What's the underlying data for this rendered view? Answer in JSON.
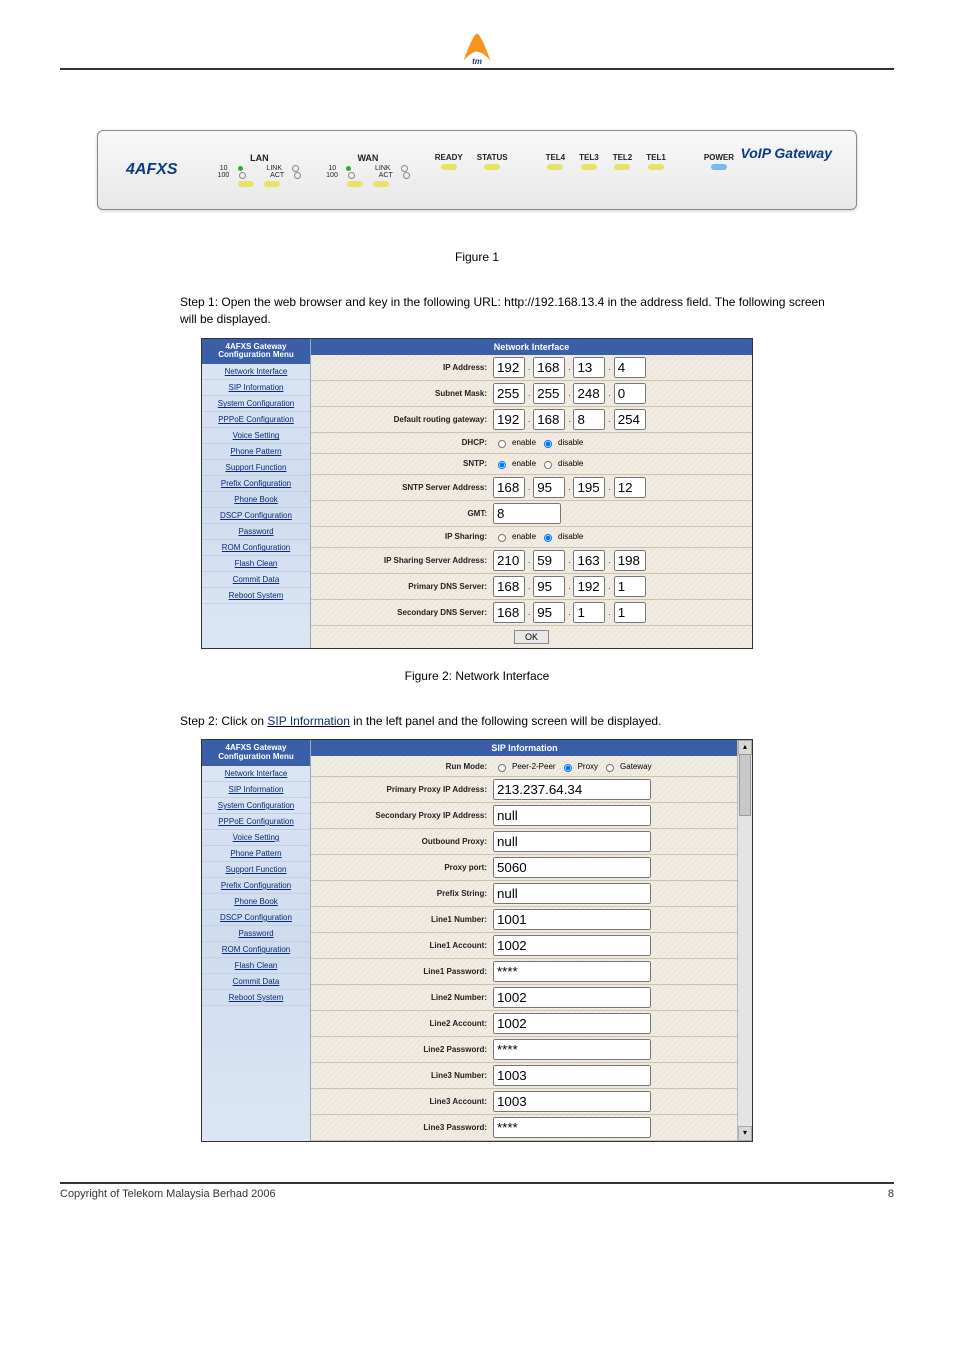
{
  "header": {
    "logo_alt": "tm-logo"
  },
  "panel": {
    "brand_left": "4AFXS",
    "brand_right": "VoIP Gateway",
    "lan_title": "LAN",
    "wan_title": "WAN",
    "speed10": "10",
    "speed100": "100",
    "link": "LINK",
    "act": "ACT",
    "ready": "READY",
    "status": "STATUS",
    "tel4": "TEL4",
    "tel3": "TEL3",
    "tel2": "TEL2",
    "tel1": "TEL1",
    "power": "POWER"
  },
  "caption1": "Figure 1",
  "step1_text": "Step 1: Open the web browser and key in the following URL: http://192.168.13.4 in the address field. The following screen will be displayed.",
  "caption2": "Figure 2: Network Interface",
  "step2_text_a": "Step 2: Click on ",
  "step2_link": "SIP Information",
  "step2_text_b": " in the left panel and the following screen will be displayed.",
  "sidebar": {
    "title": "4AFXS Gateway Configuration Menu",
    "items": [
      "Network Interface",
      "SIP Information",
      "System Configuration",
      "PPPoE Configuration",
      "Voice Setting",
      "Phone Pattern",
      "Support Function",
      "Prefix Configuration",
      "Phone Book",
      "DSCP Configuration",
      "Password",
      "ROM Configuration",
      "Flash Clean",
      "Commit Data",
      "Reboot System"
    ]
  },
  "net": {
    "title": "Network Interface",
    "rows": {
      "ip_label": "IP Address:",
      "ip": [
        "192",
        "168",
        "13",
        "4"
      ],
      "mask_label": "Subnet Mask:",
      "mask": [
        "255",
        "255",
        "248",
        "0"
      ],
      "gw_label": "Default routing gateway:",
      "gw": [
        "192",
        "168",
        "8",
        "254"
      ],
      "dhcp_label": "DHCP:",
      "enable": "enable",
      "disable": "disable",
      "sntp_label": "SNTP:",
      "sntp_addr_label": "SNTP Server Address:",
      "sntp_addr": [
        "168",
        "95",
        "195",
        "12"
      ],
      "gmt_label": "GMT:",
      "gmt": "8",
      "ipshare_label": "IP Sharing:",
      "ipshare_addr_label": "IP Sharing Server Address:",
      "ipshare_addr": [
        "210",
        "59",
        "163",
        "198"
      ],
      "pdns_label": "Primary DNS Server:",
      "pdns": [
        "168",
        "95",
        "192",
        "1"
      ],
      "sdns_label": "Secondary DNS Server:",
      "sdns": [
        "168",
        "95",
        "1",
        "1"
      ],
      "ok": "OK"
    }
  },
  "sip": {
    "title": "SIP Information",
    "rows": {
      "runmode_label": "Run Mode:",
      "rm_p2p": "Peer-2-Peer",
      "rm_proxy": "Proxy",
      "rm_gw": "Gateway",
      "pproxy_label": "Primary Proxy IP Address:",
      "pproxy": "213.237.64.34",
      "sproxy_label": "Secondary Proxy IP Address:",
      "sproxy": "null",
      "oproxy_label": "Outbound Proxy:",
      "oproxy": "null",
      "pport_label": "Proxy port:",
      "pport": "5060",
      "prefix_label": "Prefix String:",
      "prefix": "null",
      "l1n_label": "Line1 Number:",
      "l1n": "1001",
      "l1a_label": "Line1 Account:",
      "l1a": "1002",
      "l1p_label": "Line1 Password:",
      "l1p": "****",
      "l2n_label": "Line2 Number:",
      "l2n": "1002",
      "l2a_label": "Line2 Account:",
      "l2a": "1002",
      "l2p_label": "Line2 Password:",
      "l2p": "****",
      "l3n_label": "Line3 Number:",
      "l3n": "1003",
      "l3a_label": "Line3 Account:",
      "l3a": "1003",
      "l3p_label": "Line3 Password:",
      "l3p": "****"
    }
  },
  "footer": {
    "left": "Copyright of Telekom Malaysia Berhad 2006",
    "right": "8"
  }
}
